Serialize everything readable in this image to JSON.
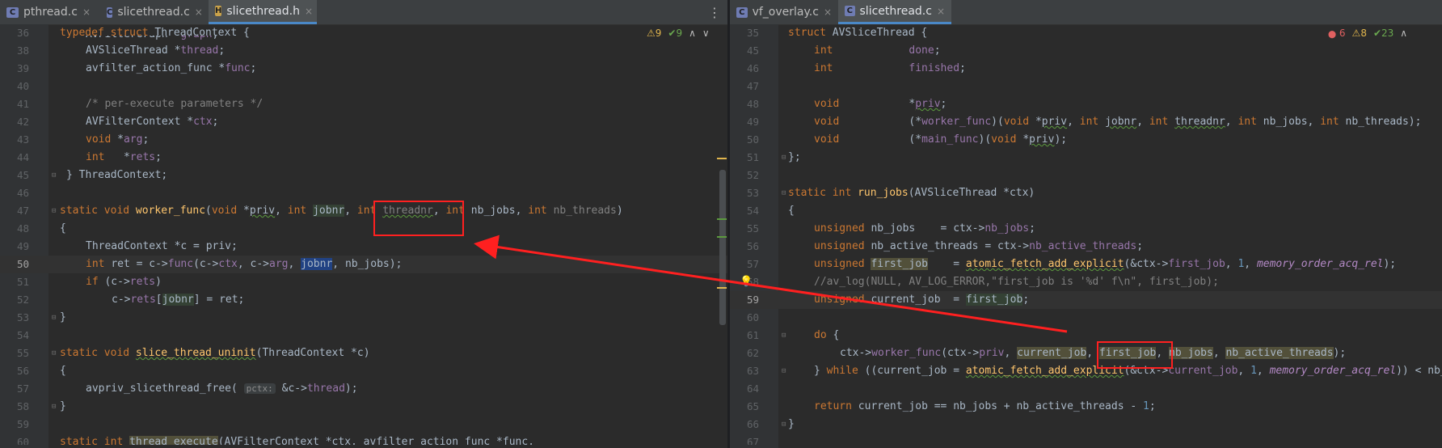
{
  "left": {
    "tabs": [
      {
        "label": "pthread.c",
        "icon": "c-file-icon",
        "glyph": "C"
      },
      {
        "label": "slicethread.c",
        "icon": "c-file-icon",
        "glyph": "C"
      },
      {
        "label": "slicethread.h",
        "icon": "h-file-icon",
        "glyph": "H"
      }
    ],
    "status": {
      "warnings": "9",
      "checks": "9"
    }
  },
  "right": {
    "tabs": [
      {
        "label": "vf_overlay.c",
        "icon": "c-file-icon",
        "glyph": "C"
      },
      {
        "label": "slicethread.c",
        "icon": "c-file-icon",
        "glyph": "C"
      }
    ],
    "status": {
      "errors": "6",
      "warnings": "8",
      "checks": "23"
    }
  },
  "glyphs": {
    "close": "×",
    "more": "⋮",
    "warn": "⚠",
    "check": "✔",
    "err": "⬤",
    "up": "∧",
    "down": "∨",
    "fold": "⊟",
    "bulb": "💡"
  },
  "colors": {
    "keyword": "#cc7832",
    "function": "#ffc66d",
    "field": "#9876aa",
    "comment": "#808080",
    "annotation": "#ff2020"
  }
}
